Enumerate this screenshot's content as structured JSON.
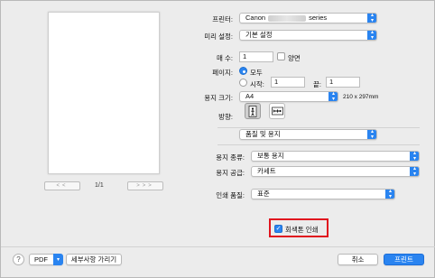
{
  "preview": {
    "first_label": "<<",
    "prev_label": "<",
    "next_label": ">",
    "last_label": ">>",
    "page_indicator": "1/1"
  },
  "printer": {
    "label": "프린터:",
    "value_prefix": "Canon",
    "value_suffix": "series"
  },
  "presets": {
    "label": "미리 설정:",
    "value": "기본 설정"
  },
  "copies": {
    "label": "매 수:",
    "value": "1",
    "duplex_label": "양면"
  },
  "pages": {
    "label": "페이지:",
    "all_label": "모두",
    "from_label": "시작:",
    "from_value": "1",
    "to_label": "끝:",
    "to_value": "1"
  },
  "paper_size": {
    "label": "용지 크기:",
    "value": "A4",
    "dimensions": "210 x 297mm"
  },
  "orientation": {
    "label": "방향:"
  },
  "section": {
    "value": "품질 및 용지"
  },
  "media_type": {
    "label": "용지 종류:",
    "value": "보통 용지"
  },
  "paper_source": {
    "label": "용지 공급:",
    "value": "카세트"
  },
  "print_quality": {
    "label": "인쇄 품질:",
    "value": "표준"
  },
  "grayscale": {
    "label": "회색톤 인쇄",
    "checked": true
  },
  "footer": {
    "help_label": "?",
    "pdf_label": "PDF",
    "details_label": "세부사항 가리기",
    "cancel_label": "취소",
    "print_label": "프린트"
  },
  "colors": {
    "accent": "#2a84f0",
    "highlight": "#e0141e"
  }
}
